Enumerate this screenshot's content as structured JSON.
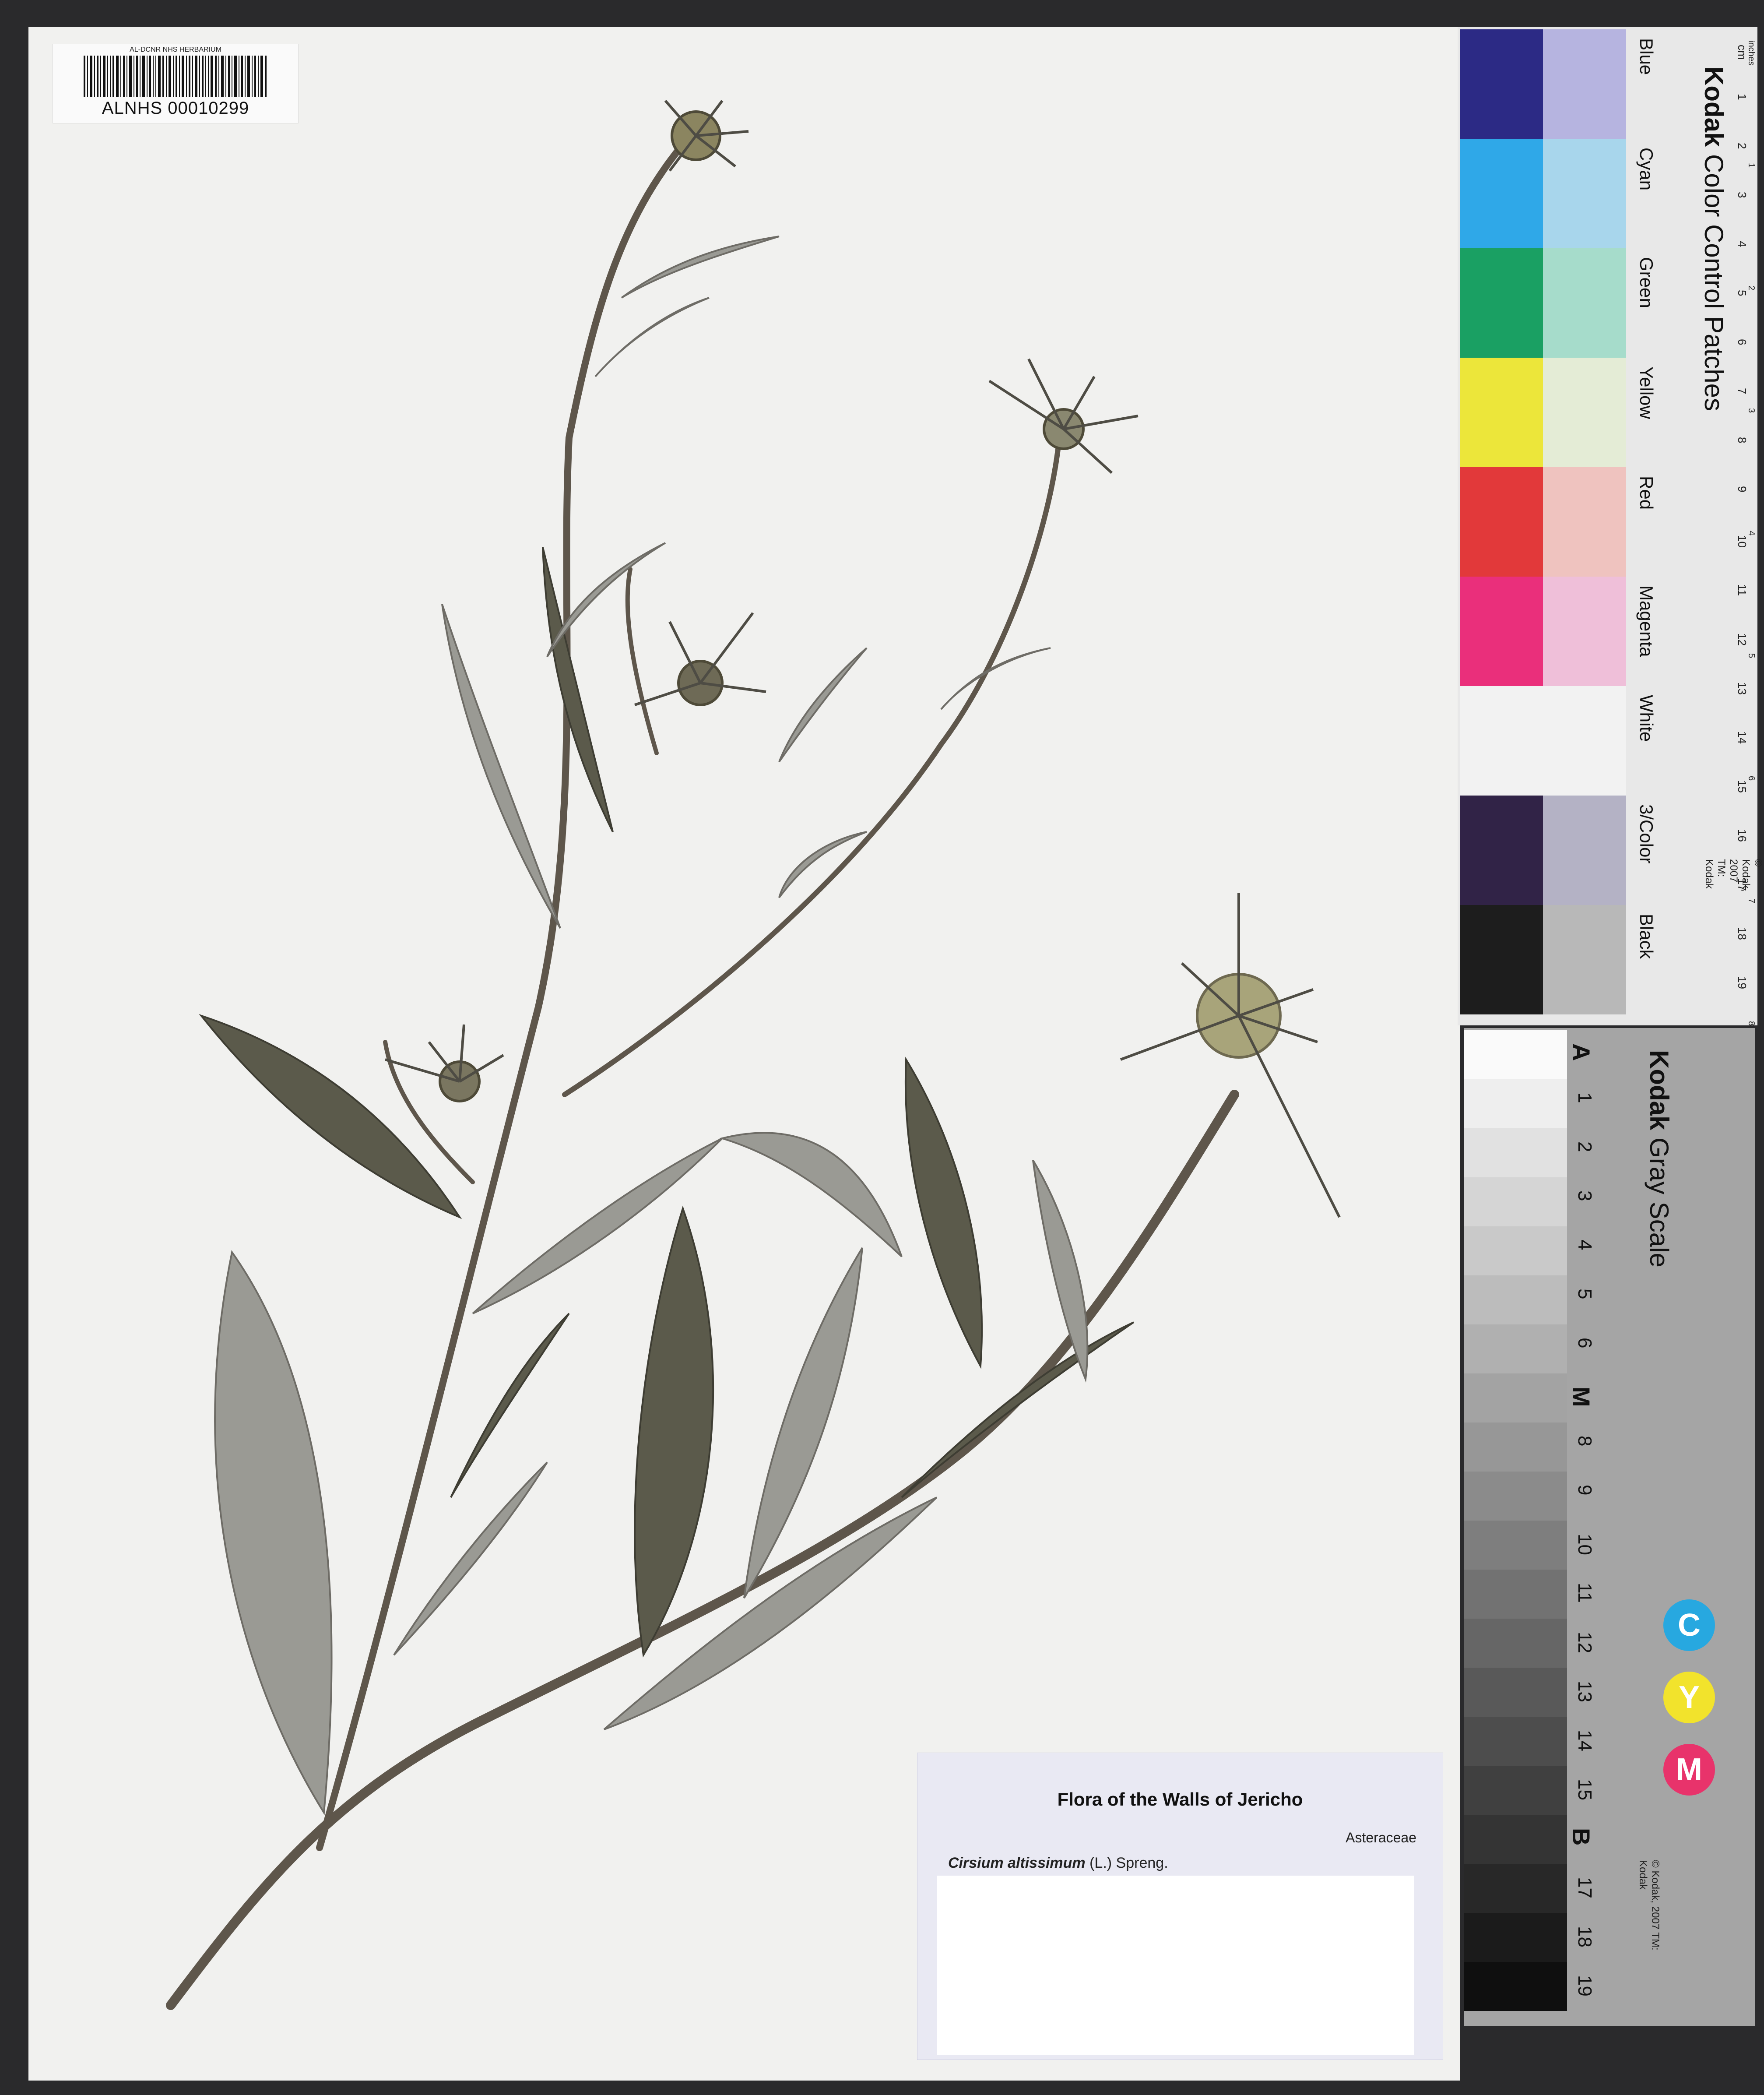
{
  "barcode": {
    "header": "AL-DCNR NHS HERBARIUM",
    "code": "ALNHS 00010299"
  },
  "label": {
    "title": "Flora of  the Walls of Jericho",
    "family": "Asteraceae",
    "species_name": "Cirsium altissimum",
    "species_authority": "(L.) Spreng."
  },
  "color_chart": {
    "brand": "Kodak",
    "title": "Color Control Patches",
    "copyright": "© Kodak, 2007 TM: Kodak",
    "patches": [
      {
        "name": "Blue",
        "dark": "#2c2a85",
        "light": "#b6b4e0"
      },
      {
        "name": "Cyan",
        "dark": "#2fa8e8",
        "light": "#a8d6ec"
      },
      {
        "name": "Green",
        "dark": "#1aa063",
        "light": "#a6dccb"
      },
      {
        "name": "Yellow",
        "dark": "#ece63a",
        "light": "#e4ecd6"
      },
      {
        "name": "Red",
        "dark": "#e2393a",
        "light": "#efc3bf"
      },
      {
        "name": "Magenta",
        "dark": "#ea2f7b",
        "light": "#efbfd9"
      },
      {
        "name": "White",
        "dark": "#f2f2f2",
        "light": "#f2f2f2"
      },
      {
        "name": "3/Color",
        "dark": "#312347",
        "light": "#b4b2c5"
      },
      {
        "name": "Black",
        "dark": "#1d1d1d",
        "light": "#b8b8b8"
      }
    ],
    "ruler_cm": [
      "cm",
      "1",
      "2",
      "3",
      "4",
      "5",
      "6",
      "7",
      "8",
      "9",
      "10",
      "11",
      "12",
      "13",
      "14",
      "15",
      "16",
      "17",
      "18",
      "19"
    ],
    "ruler_inches": [
      "inches",
      "1",
      "2",
      "3",
      "4",
      "5",
      "6",
      "7",
      "8"
    ]
  },
  "gray_chart": {
    "brand": "Kodak",
    "title": "Gray Scale",
    "copyright": "© Kodak, 2007 TM: Kodak",
    "steps": [
      "A",
      "1",
      "2",
      "3",
      "4",
      "5",
      "6",
      "M",
      "8",
      "9",
      "10",
      "11",
      "12",
      "13",
      "14",
      "15",
      "B",
      "17",
      "18",
      "19"
    ],
    "cym": [
      {
        "letter": "C",
        "color": "#27a8e0"
      },
      {
        "letter": "Y",
        "color": "#f2e32c"
      },
      {
        "letter": "M",
        "color": "#e8336b"
      }
    ]
  }
}
